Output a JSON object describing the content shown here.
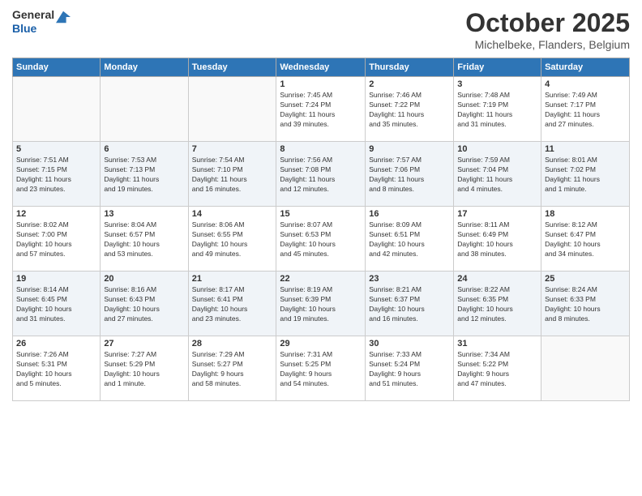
{
  "header": {
    "logo_general": "General",
    "logo_blue": "Blue",
    "month_title": "October 2025",
    "location": "Michelbeke, Flanders, Belgium"
  },
  "days_of_week": [
    "Sunday",
    "Monday",
    "Tuesday",
    "Wednesday",
    "Thursday",
    "Friday",
    "Saturday"
  ],
  "weeks": [
    [
      {
        "day": "",
        "info": ""
      },
      {
        "day": "",
        "info": ""
      },
      {
        "day": "",
        "info": ""
      },
      {
        "day": "1",
        "info": "Sunrise: 7:45 AM\nSunset: 7:24 PM\nDaylight: 11 hours\nand 39 minutes."
      },
      {
        "day": "2",
        "info": "Sunrise: 7:46 AM\nSunset: 7:22 PM\nDaylight: 11 hours\nand 35 minutes."
      },
      {
        "day": "3",
        "info": "Sunrise: 7:48 AM\nSunset: 7:19 PM\nDaylight: 11 hours\nand 31 minutes."
      },
      {
        "day": "4",
        "info": "Sunrise: 7:49 AM\nSunset: 7:17 PM\nDaylight: 11 hours\nand 27 minutes."
      }
    ],
    [
      {
        "day": "5",
        "info": "Sunrise: 7:51 AM\nSunset: 7:15 PM\nDaylight: 11 hours\nand 23 minutes."
      },
      {
        "day": "6",
        "info": "Sunrise: 7:53 AM\nSunset: 7:13 PM\nDaylight: 11 hours\nand 19 minutes."
      },
      {
        "day": "7",
        "info": "Sunrise: 7:54 AM\nSunset: 7:10 PM\nDaylight: 11 hours\nand 16 minutes."
      },
      {
        "day": "8",
        "info": "Sunrise: 7:56 AM\nSunset: 7:08 PM\nDaylight: 11 hours\nand 12 minutes."
      },
      {
        "day": "9",
        "info": "Sunrise: 7:57 AM\nSunset: 7:06 PM\nDaylight: 11 hours\nand 8 minutes."
      },
      {
        "day": "10",
        "info": "Sunrise: 7:59 AM\nSunset: 7:04 PM\nDaylight: 11 hours\nand 4 minutes."
      },
      {
        "day": "11",
        "info": "Sunrise: 8:01 AM\nSunset: 7:02 PM\nDaylight: 11 hours\nand 1 minute."
      }
    ],
    [
      {
        "day": "12",
        "info": "Sunrise: 8:02 AM\nSunset: 7:00 PM\nDaylight: 10 hours\nand 57 minutes."
      },
      {
        "day": "13",
        "info": "Sunrise: 8:04 AM\nSunset: 6:57 PM\nDaylight: 10 hours\nand 53 minutes."
      },
      {
        "day": "14",
        "info": "Sunrise: 8:06 AM\nSunset: 6:55 PM\nDaylight: 10 hours\nand 49 minutes."
      },
      {
        "day": "15",
        "info": "Sunrise: 8:07 AM\nSunset: 6:53 PM\nDaylight: 10 hours\nand 45 minutes."
      },
      {
        "day": "16",
        "info": "Sunrise: 8:09 AM\nSunset: 6:51 PM\nDaylight: 10 hours\nand 42 minutes."
      },
      {
        "day": "17",
        "info": "Sunrise: 8:11 AM\nSunset: 6:49 PM\nDaylight: 10 hours\nand 38 minutes."
      },
      {
        "day": "18",
        "info": "Sunrise: 8:12 AM\nSunset: 6:47 PM\nDaylight: 10 hours\nand 34 minutes."
      }
    ],
    [
      {
        "day": "19",
        "info": "Sunrise: 8:14 AM\nSunset: 6:45 PM\nDaylight: 10 hours\nand 31 minutes."
      },
      {
        "day": "20",
        "info": "Sunrise: 8:16 AM\nSunset: 6:43 PM\nDaylight: 10 hours\nand 27 minutes."
      },
      {
        "day": "21",
        "info": "Sunrise: 8:17 AM\nSunset: 6:41 PM\nDaylight: 10 hours\nand 23 minutes."
      },
      {
        "day": "22",
        "info": "Sunrise: 8:19 AM\nSunset: 6:39 PM\nDaylight: 10 hours\nand 19 minutes."
      },
      {
        "day": "23",
        "info": "Sunrise: 8:21 AM\nSunset: 6:37 PM\nDaylight: 10 hours\nand 16 minutes."
      },
      {
        "day": "24",
        "info": "Sunrise: 8:22 AM\nSunset: 6:35 PM\nDaylight: 10 hours\nand 12 minutes."
      },
      {
        "day": "25",
        "info": "Sunrise: 8:24 AM\nSunset: 6:33 PM\nDaylight: 10 hours\nand 8 minutes."
      }
    ],
    [
      {
        "day": "26",
        "info": "Sunrise: 7:26 AM\nSunset: 5:31 PM\nDaylight: 10 hours\nand 5 minutes."
      },
      {
        "day": "27",
        "info": "Sunrise: 7:27 AM\nSunset: 5:29 PM\nDaylight: 10 hours\nand 1 minute."
      },
      {
        "day": "28",
        "info": "Sunrise: 7:29 AM\nSunset: 5:27 PM\nDaylight: 9 hours\nand 58 minutes."
      },
      {
        "day": "29",
        "info": "Sunrise: 7:31 AM\nSunset: 5:25 PM\nDaylight: 9 hours\nand 54 minutes."
      },
      {
        "day": "30",
        "info": "Sunrise: 7:33 AM\nSunset: 5:24 PM\nDaylight: 9 hours\nand 51 minutes."
      },
      {
        "day": "31",
        "info": "Sunrise: 7:34 AM\nSunset: 5:22 PM\nDaylight: 9 hours\nand 47 minutes."
      },
      {
        "day": "",
        "info": ""
      }
    ]
  ]
}
